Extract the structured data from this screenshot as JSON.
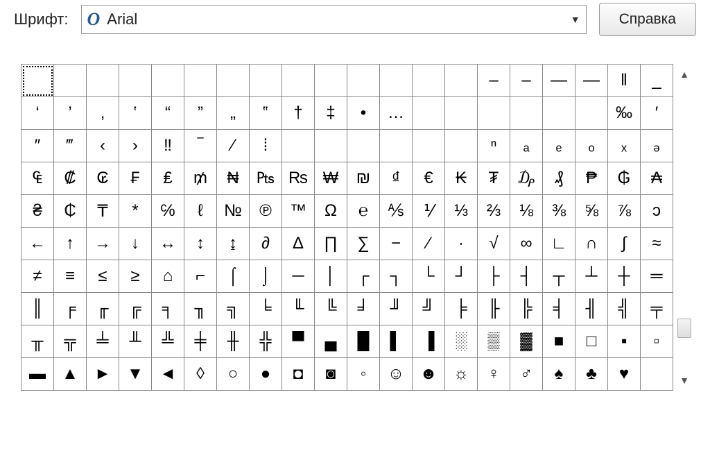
{
  "toolbar": {
    "font_label": "Шрифт:",
    "font_name": "Arial",
    "help_label": "Справка"
  },
  "grid": {
    "rows": [
      [
        "",
        "",
        "",
        "",
        "",
        "",
        "",
        "",
        "",
        "",
        "",
        "",
        "",
        "",
        "‒",
        "–",
        "—",
        "―",
        "‖",
        "_"
      ],
      [
        "‘",
        "’",
        "‚",
        "‛",
        "“",
        "”",
        "„",
        "‟",
        "†",
        "‡",
        "•",
        "…",
        "",
        "",
        "",
        "",
        "",
        "",
        "‰",
        "′"
      ],
      [
        "″",
        "‴",
        "‹",
        "›",
        "‼",
        "‾",
        "⁄",
        "⁞",
        "",
        "",
        "",
        "",
        "",
        "",
        "ⁿ",
        "ₐ",
        "ₑ",
        "ₒ",
        "ₓ",
        "ₔ"
      ],
      [
        "₠",
        "₡",
        "₢",
        "₣",
        "₤",
        "₥",
        "₦",
        "₧",
        "₨",
        "₩",
        "₪",
        "₫",
        "€",
        "₭",
        "₮",
        "₯",
        "₰",
        "₱",
        "₲",
        "₳"
      ],
      [
        "₴",
        "₵",
        "₸",
        "*",
        "℅",
        "ℓ",
        "№",
        "℗",
        "™",
        "Ω",
        "℮",
        "⅍",
        "⅟",
        "⅓",
        "⅔",
        "⅛",
        "⅜",
        "⅝",
        "⅞",
        "ↄ"
      ],
      [
        "←",
        "↑",
        "→",
        "↓",
        "↔",
        "↕",
        "↨",
        "∂",
        "∆",
        "∏",
        "∑",
        "−",
        "∕",
        "∙",
        "√",
        "∞",
        "∟",
        "∩",
        "∫",
        "≈"
      ],
      [
        "≠",
        "≡",
        "≤",
        "≥",
        "⌂",
        "⌐",
        "⌠",
        "⌡",
        "─",
        "│",
        "┌",
        "┐",
        "└",
        "┘",
        "├",
        "┤",
        "┬",
        "┴",
        "┼",
        "═"
      ],
      [
        "║",
        "╒",
        "╓",
        "╔",
        "╕",
        "╖",
        "╗",
        "╘",
        "╙",
        "╚",
        "╛",
        "╜",
        "╝",
        "╞",
        "╟",
        "╠",
        "╡",
        "╢",
        "╣",
        "╤"
      ],
      [
        "╥",
        "╦",
        "╧",
        "╨",
        "╩",
        "╪",
        "╫",
        "╬",
        "▀",
        "▄",
        "█",
        "▌",
        "▐",
        "░",
        "▒",
        "▓",
        "■",
        "□",
        "▪",
        "▫"
      ],
      [
        "▬",
        "▲",
        "►",
        "▼",
        "◄",
        "◊",
        "○",
        "●",
        "◘",
        "◙",
        "◦",
        "☺",
        "☻",
        "☼",
        "♀",
        "♂",
        "♠",
        "♣",
        "♥",
        ""
      ]
    ]
  }
}
